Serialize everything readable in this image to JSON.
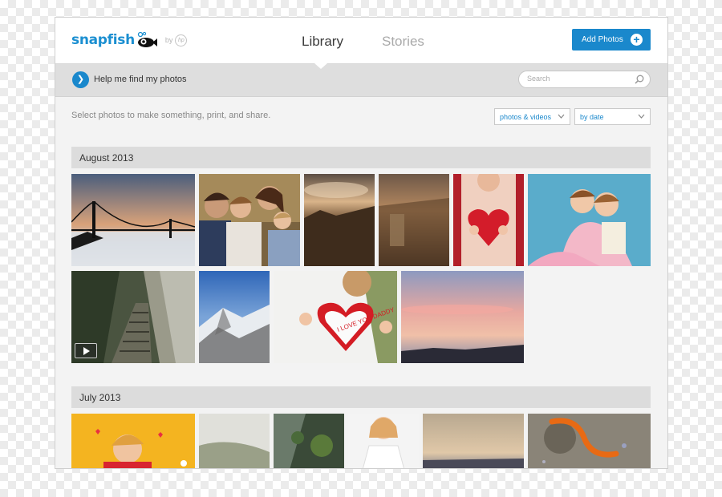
{
  "header": {
    "logo_text": "snapfish",
    "logo_by": "by",
    "hp_mark": "hp",
    "tabs": [
      {
        "label": "Library",
        "active": true
      },
      {
        "label": "Stories",
        "active": false
      }
    ],
    "add_photos_label": "Add Photos",
    "add_icon": "plus-circle-icon"
  },
  "helpbar": {
    "label": "Help me find my photos",
    "arrow_icon": "chevron-right-circle-icon",
    "search_placeholder": "Search",
    "search_icon": "magnifier-icon"
  },
  "toolbar": {
    "instruction": "Select photos to make something, print, and share.",
    "filter_value": "photos & videos",
    "sort_value": "by date"
  },
  "sections": [
    {
      "title": "August 2013",
      "photos": [
        {
          "subject": "golden-gate-bridge-fog"
        },
        {
          "subject": "family-portrait"
        },
        {
          "subject": "sunset-clouds-field"
        },
        {
          "subject": "waterfall-sunset"
        },
        {
          "subject": "girl-holding-heart"
        },
        {
          "subject": "two-girls-hugging"
        },
        {
          "subject": "forest-stairway",
          "is_video": true
        },
        {
          "subject": "snowy-mountains"
        },
        {
          "subject": "hug-with-heart-card"
        },
        {
          "subject": "pink-sunset-sky"
        }
      ]
    },
    {
      "title": "July 2013",
      "photos": [
        {
          "subject": "girl-yellow-background"
        },
        {
          "subject": "foggy-hillside"
        },
        {
          "subject": "mossy-rocks"
        },
        {
          "subject": "girl-white-dress"
        },
        {
          "subject": "sunset-horizon"
        },
        {
          "subject": "orange-salamander"
        }
      ]
    }
  ],
  "heart_card_text": "I LOVE YOU DADDY",
  "colors": {
    "accent": "#1a88cc",
    "logo": "#1b8fd1"
  }
}
